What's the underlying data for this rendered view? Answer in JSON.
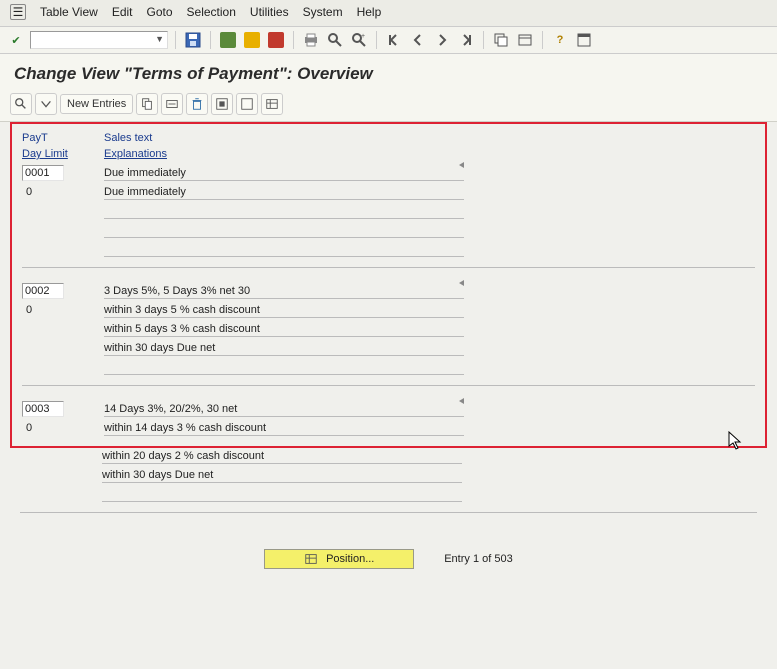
{
  "menu": {
    "items": [
      "Table View",
      "Edit",
      "Goto",
      "Selection",
      "Utilities",
      "System",
      "Help"
    ]
  },
  "title": "Change View \"Terms of Payment\": Overview",
  "app_toolbar": {
    "new_entries": "New Entries"
  },
  "columns": {
    "payt": "PayT",
    "sales_text": "Sales text",
    "day_limit": "Day Limit",
    "explanations": "Explanations"
  },
  "entries": [
    {
      "key": "0001",
      "day_limit": "0",
      "sales_text": "Due immediately",
      "lines": [
        "Due immediately",
        "",
        "",
        ""
      ]
    },
    {
      "key": "0002",
      "day_limit": "0",
      "sales_text": "3 Days 5%, 5 Days 3% net 30",
      "lines": [
        "within 3 days 5 % cash discount",
        "within 5 days 3 % cash discount",
        "within 30 days Due net",
        ""
      ]
    },
    {
      "key": "0003",
      "day_limit": "0",
      "sales_text": "14 Days 3%, 20/2%, 30 net",
      "lines": [
        "within 14 days 3 % cash discount",
        "within 20 days 2 % cash discount",
        "within 30 days Due net",
        ""
      ]
    }
  ],
  "footer": {
    "position_btn": "Position...",
    "entry_label": "Entry",
    "entry_current": "1",
    "entry_of": "of",
    "entry_total": "503"
  },
  "icons": {
    "enter": "✓",
    "save": "💾",
    "back": "◀",
    "exit": "✖",
    "cancel": "⦸",
    "print": "🖨",
    "find": "🔍",
    "findnext": "🔎",
    "firstpage": "⏮",
    "prevpage": "◀",
    "nextpage": "▶",
    "lastpage": "⏭",
    "newsess": "❐",
    "shortcut": "⌂",
    "help": "❔",
    "layout": "☰"
  }
}
